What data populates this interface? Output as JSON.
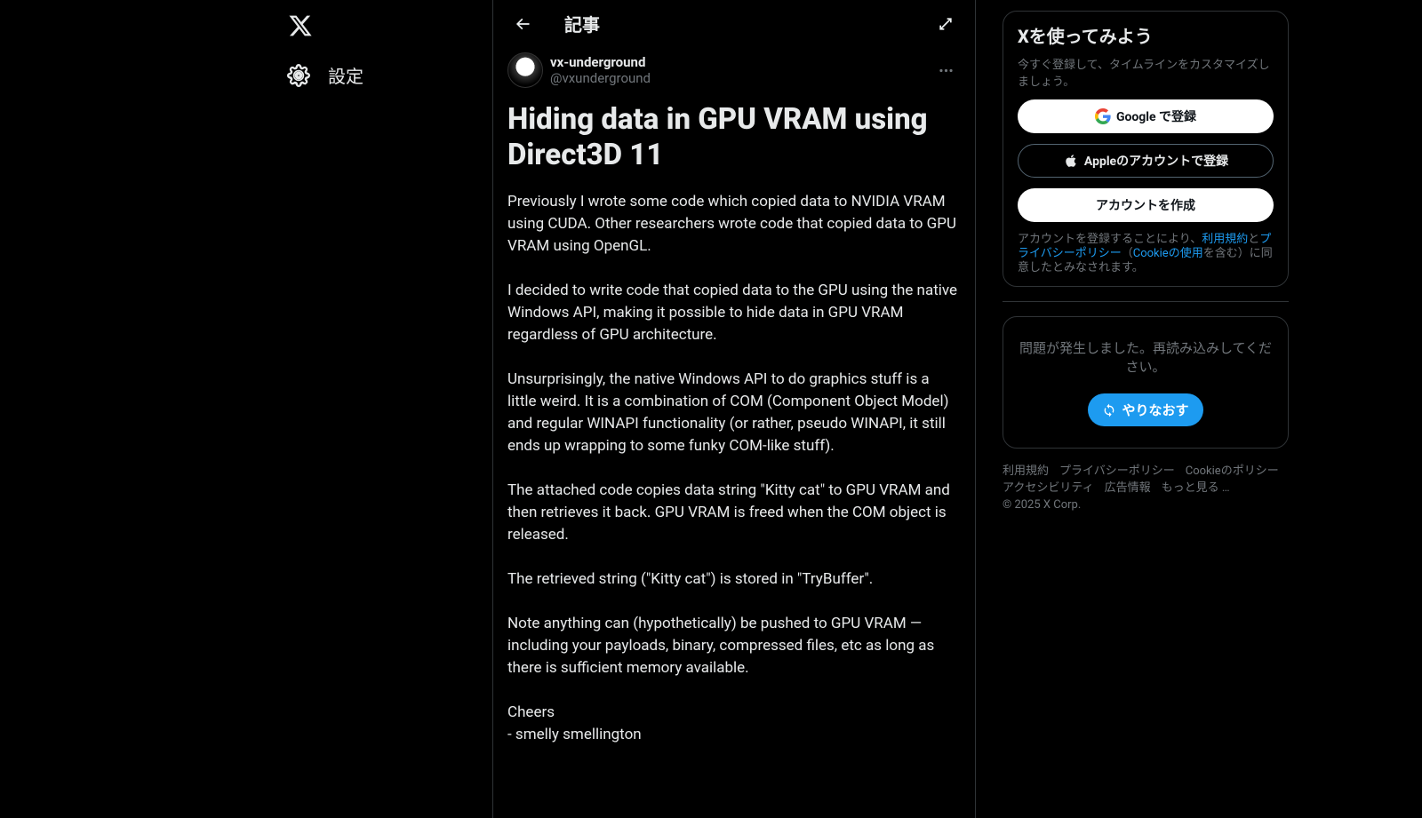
{
  "nav": {
    "settings": "設定"
  },
  "header": {
    "title": "記事"
  },
  "article": {
    "author_name": "vx-underground",
    "author_handle": "@vxunderground",
    "title": "Hiding data in GPU VRAM using Direct3D 11",
    "paragraphs": [
      "Previously I wrote some code which copied data to NVIDIA VRAM using CUDA. Other researchers wrote code that copied data to GPU VRAM using OpenGL.",
      "I decided to write code that copied data to the GPU using the native Windows API, making it possible to hide data in GPU VRAM regardless of GPU architecture.",
      "Unsurprisingly, the native Windows API to do graphics stuff is a little weird. It is a combination of COM (Component Object Model) and regular WINAPI functionality (or rather, pseudo WINAPI, it still ends up wrapping to some funky COM-like stuff).",
      "The attached code copies data string \"Kitty cat\" to GPU VRAM and then retrieves it back. GPU VRAM is freed when the COM object is released.",
      "The retrieved string (\"Kitty cat\") is stored in \"TryBuffer\".",
      "Note anything can (hypothetically) be pushed to GPU VRAM — including your payloads, binary, compressed files, etc as long as there is sufficient memory available."
    ],
    "signature1": "Cheers",
    "signature2": "- smelly smellington"
  },
  "signup": {
    "title": "Xを使ってみよう",
    "subtitle": "今すぐ登録して、タイムラインをカスタマイズしましょう。",
    "google": "Google で登録",
    "apple": "Appleのアカウントで登録",
    "create": "アカウントを作成",
    "terms_prefix": "アカウントを登録することにより、",
    "terms_tos": "利用規約",
    "terms_and": "と",
    "terms_privacy": "プライバシーポリシー",
    "terms_open": "（",
    "terms_cookie": "Cookieの使用",
    "terms_suffix": "を含む）に同意したとみなされます。"
  },
  "error": {
    "message": "問題が発生しました。再読み込みしてください。",
    "retry": "やりなおす"
  },
  "footer": {
    "tos": "利用規約",
    "privacy": "プライバシーポリシー",
    "cookie": "Cookieのポリシー",
    "accessibility": "アクセシビリティ",
    "ads": "広告情報",
    "more": "もっと見る …",
    "copyright": "© 2025 X Corp."
  }
}
